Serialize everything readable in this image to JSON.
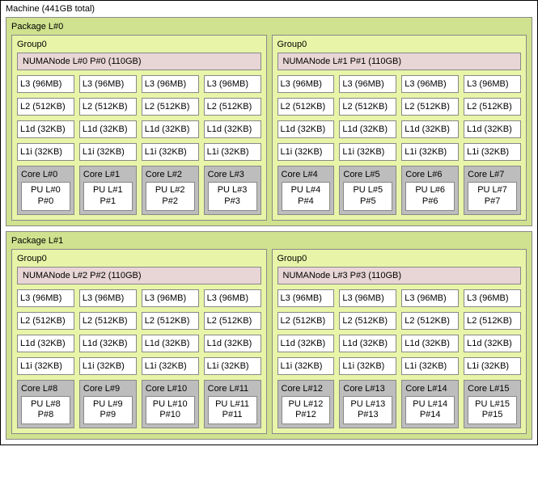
{
  "machine": {
    "title": "Machine (441GB total)",
    "packages": [
      {
        "title": "Package L#0",
        "groups": [
          {
            "title": "Group0",
            "numa": "NUMANode L#0 P#0 (110GB)",
            "caches": {
              "l3": [
                "L3 (96MB)",
                "L3 (96MB)",
                "L3 (96MB)",
                "L3 (96MB)"
              ],
              "l2": [
                "L2 (512KB)",
                "L2 (512KB)",
                "L2 (512KB)",
                "L2 (512KB)"
              ],
              "l1d": [
                "L1d (32KB)",
                "L1d (32KB)",
                "L1d (32KB)",
                "L1d (32KB)"
              ],
              "l1i": [
                "L1i (32KB)",
                "L1i (32KB)",
                "L1i (32KB)",
                "L1i (32KB)"
              ]
            },
            "cores": [
              {
                "core": "Core L#0",
                "pu_l": "PU L#0",
                "pu_p": "P#0"
              },
              {
                "core": "Core L#1",
                "pu_l": "PU L#1",
                "pu_p": "P#1"
              },
              {
                "core": "Core L#2",
                "pu_l": "PU L#2",
                "pu_p": "P#2"
              },
              {
                "core": "Core L#3",
                "pu_l": "PU L#3",
                "pu_p": "P#3"
              }
            ]
          },
          {
            "title": "Group0",
            "numa": "NUMANode L#1 P#1 (110GB)",
            "caches": {
              "l3": [
                "L3 (96MB)",
                "L3 (96MB)",
                "L3 (96MB)",
                "L3 (96MB)"
              ],
              "l2": [
                "L2 (512KB)",
                "L2 (512KB)",
                "L2 (512KB)",
                "L2 (512KB)"
              ],
              "l1d": [
                "L1d (32KB)",
                "L1d (32KB)",
                "L1d (32KB)",
                "L1d (32KB)"
              ],
              "l1i": [
                "L1i (32KB)",
                "L1i (32KB)",
                "L1i (32KB)",
                "L1i (32KB)"
              ]
            },
            "cores": [
              {
                "core": "Core L#4",
                "pu_l": "PU L#4",
                "pu_p": "P#4"
              },
              {
                "core": "Core L#5",
                "pu_l": "PU L#5",
                "pu_p": "P#5"
              },
              {
                "core": "Core L#6",
                "pu_l": "PU L#6",
                "pu_p": "P#6"
              },
              {
                "core": "Core L#7",
                "pu_l": "PU L#7",
                "pu_p": "P#7"
              }
            ]
          }
        ]
      },
      {
        "title": "Package L#1",
        "groups": [
          {
            "title": "Group0",
            "numa": "NUMANode L#2 P#2 (110GB)",
            "caches": {
              "l3": [
                "L3 (96MB)",
                "L3 (96MB)",
                "L3 (96MB)",
                "L3 (96MB)"
              ],
              "l2": [
                "L2 (512KB)",
                "L2 (512KB)",
                "L2 (512KB)",
                "L2 (512KB)"
              ],
              "l1d": [
                "L1d (32KB)",
                "L1d (32KB)",
                "L1d (32KB)",
                "L1d (32KB)"
              ],
              "l1i": [
                "L1i (32KB)",
                "L1i (32KB)",
                "L1i (32KB)",
                "L1i (32KB)"
              ]
            },
            "cores": [
              {
                "core": "Core L#8",
                "pu_l": "PU L#8",
                "pu_p": "P#8"
              },
              {
                "core": "Core L#9",
                "pu_l": "PU L#9",
                "pu_p": "P#9"
              },
              {
                "core": "Core L#10",
                "pu_l": "PU L#10",
                "pu_p": "P#10"
              },
              {
                "core": "Core L#11",
                "pu_l": "PU L#11",
                "pu_p": "P#11"
              }
            ]
          },
          {
            "title": "Group0",
            "numa": "NUMANode L#3 P#3 (110GB)",
            "caches": {
              "l3": [
                "L3 (96MB)",
                "L3 (96MB)",
                "L3 (96MB)",
                "L3 (96MB)"
              ],
              "l2": [
                "L2 (512KB)",
                "L2 (512KB)",
                "L2 (512KB)",
                "L2 (512KB)"
              ],
              "l1d": [
                "L1d (32KB)",
                "L1d (32KB)",
                "L1d (32KB)",
                "L1d (32KB)"
              ],
              "l1i": [
                "L1i (32KB)",
                "L1i (32KB)",
                "L1i (32KB)",
                "L1i (32KB)"
              ]
            },
            "cores": [
              {
                "core": "Core L#12",
                "pu_l": "PU L#12",
                "pu_p": "P#12"
              },
              {
                "core": "Core L#13",
                "pu_l": "PU L#13",
                "pu_p": "P#13"
              },
              {
                "core": "Core L#14",
                "pu_l": "PU L#14",
                "pu_p": "P#14"
              },
              {
                "core": "Core L#15",
                "pu_l": "PU L#15",
                "pu_p": "P#15"
              }
            ]
          }
        ]
      }
    ]
  }
}
